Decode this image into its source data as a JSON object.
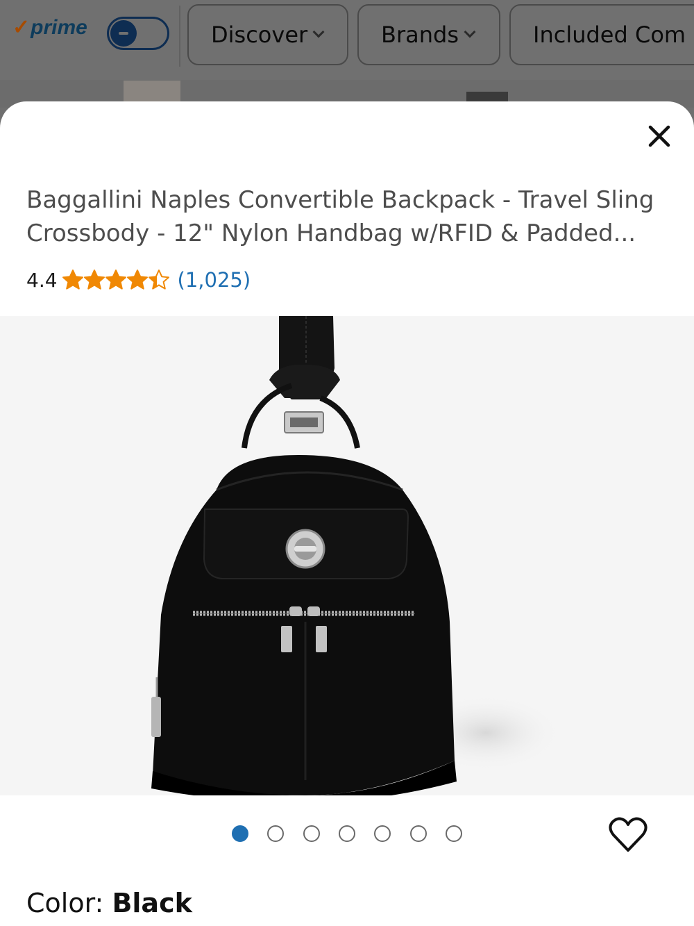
{
  "filter_bar": {
    "prime_label": "prime",
    "prime_toggle_state": "off",
    "chips": [
      {
        "label": "Discover"
      },
      {
        "label": "Brands"
      },
      {
        "label": "Included Com"
      }
    ]
  },
  "product": {
    "title": "Baggallini Naples Convertible Backpack - Travel Sling Crossbody - 12\" Nylon Handbag w/RFID & Padded...",
    "rating_value": "4.4",
    "stars_out_of_5": 4.4,
    "review_count": "(1,025)",
    "image_alt": "black backpack",
    "carousel": {
      "total": 7,
      "active_index": 0
    },
    "color_label": "Color: ",
    "color_value": "Black"
  },
  "colors": {
    "star": "#f08804",
    "link": "#1f6fb2",
    "dot_active": "#1f6fb2"
  },
  "icons": {
    "close": "close-icon",
    "favorite": "heart-icon",
    "star": "star-icon",
    "prime_check": "check-icon"
  }
}
